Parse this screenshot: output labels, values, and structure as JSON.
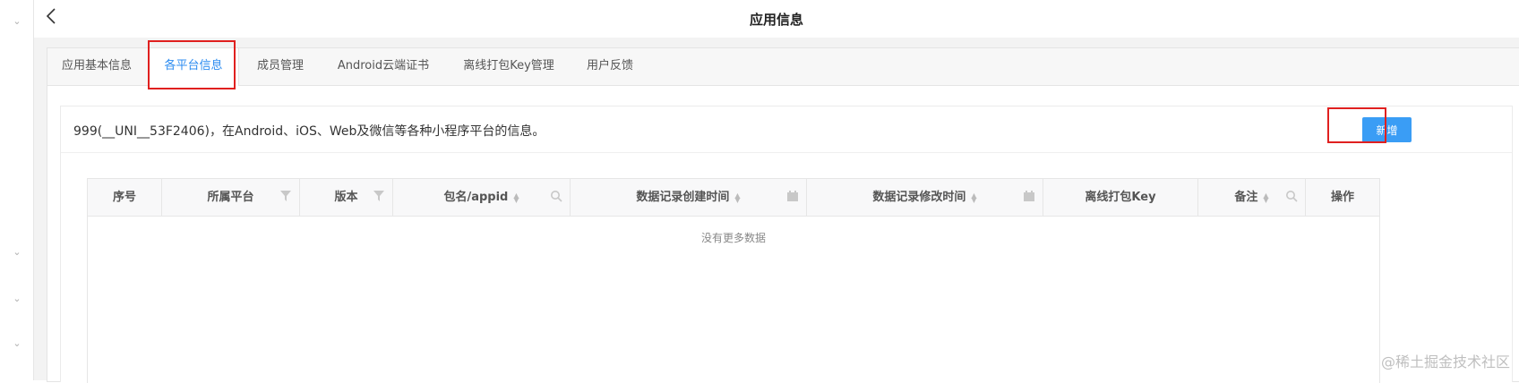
{
  "header": {
    "title": "应用信息"
  },
  "tabs": [
    {
      "label": "应用基本信息"
    },
    {
      "label": "各平台信息"
    },
    {
      "label": "成员管理"
    },
    {
      "label": "Android云端证书"
    },
    {
      "label": "离线打包Key管理"
    },
    {
      "label": "用户反馈"
    }
  ],
  "active_tab": "各平台信息",
  "card": {
    "description": "999(__UNI__53F2406)，在Android、iOS、Web及微信等各种小程序平台的信息。",
    "add_button": "新增"
  },
  "table": {
    "columns": [
      {
        "label": "序号"
      },
      {
        "label": "所属平台"
      },
      {
        "label": "版本"
      },
      {
        "label": "包名/appid"
      },
      {
        "label": "数据记录创建时间"
      },
      {
        "label": "数据记录修改时间"
      },
      {
        "label": "离线打包Key"
      },
      {
        "label": "备注"
      },
      {
        "label": "操作"
      }
    ],
    "empty_text": "没有更多数据"
  },
  "watermark": "@稀土掘金技术社区",
  "colors": {
    "accent": "#2d8cf0",
    "button": "#3a9df5",
    "highlight": "#e0201f"
  }
}
